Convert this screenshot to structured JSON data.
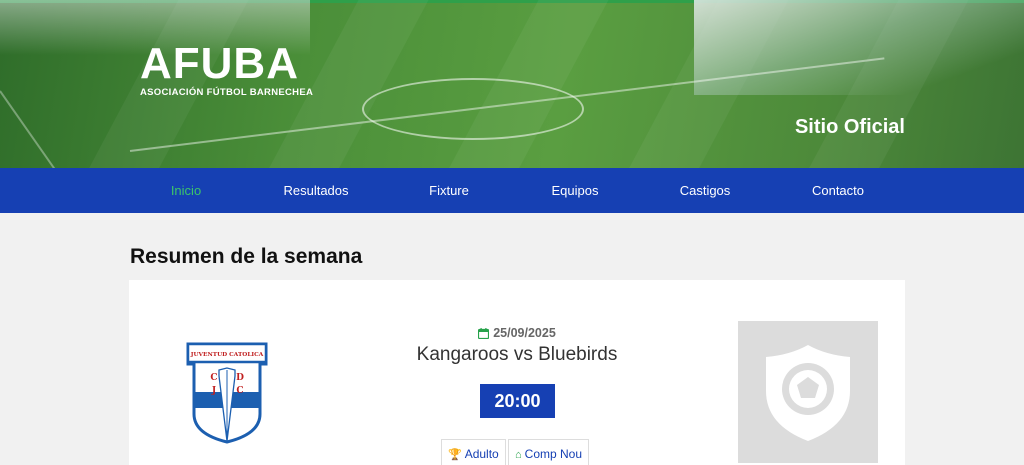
{
  "header": {
    "logo_title": "AFUBA",
    "logo_subtitle": "ASOCIACIÓN FÚTBOL BARNECHEA",
    "tagline": "Sitio Oficial"
  },
  "nav": {
    "items": [
      {
        "label": "Inicio",
        "active": true
      },
      {
        "label": "Resultados",
        "active": false
      },
      {
        "label": "Fixture",
        "active": false
      },
      {
        "label": "Equipos",
        "active": false
      },
      {
        "label": "Castigos",
        "active": false
      },
      {
        "label": "Contacto",
        "active": false
      }
    ]
  },
  "main": {
    "section_title": "Resumen de la semana",
    "match": {
      "date": "25/09/2025",
      "title": "Kangaroos vs Bluebirds",
      "time": "20:00",
      "category": "Adulto",
      "venue": "Comp Nou",
      "home_crest": {
        "banner": "JUVENTUD CATOLICA",
        "letters": [
          "C",
          "D",
          "J",
          "C"
        ]
      },
      "away_crest": "placeholder-shield-icon"
    }
  },
  "colors": {
    "nav_bg": "#1640b3",
    "active_nav": "#3cc46a",
    "accent_green": "#27a24b",
    "time_box": "#1640b3"
  }
}
